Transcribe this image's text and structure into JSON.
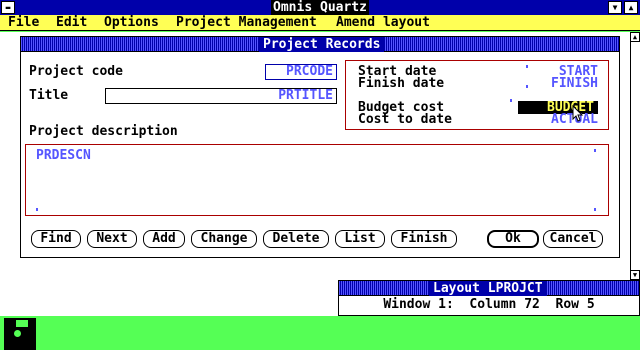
{
  "app": {
    "title": "Omnis Quartz"
  },
  "menu": [
    "File",
    "Edit",
    "Options",
    "Project Management",
    "Amend layout"
  ],
  "window": {
    "title": "Project Records",
    "fields": {
      "project_code": {
        "label": "Project code",
        "value": "PRCODE"
      },
      "title": {
        "label": "Title",
        "value": "PRTITLE"
      },
      "description": {
        "label": "Project description",
        "value": "PRDESCN"
      },
      "start_date": {
        "label": "Start date",
        "value": "START"
      },
      "finish_date": {
        "label": "Finish date",
        "value": "FINISH"
      },
      "budget_cost": {
        "label": "Budget cost",
        "value": "BUDGET"
      },
      "cost_to_date": {
        "label": "Cost to date",
        "value": "ACTUAL"
      }
    },
    "buttons": [
      "Find",
      "Next",
      "Add",
      "Change",
      "Delete",
      "List",
      "Finish",
      "Ok",
      "Cancel"
    ]
  },
  "layout_window": {
    "title": "Layout LPROJCT",
    "status": "Window 1:  Column 72  Row 5"
  },
  "colors": {
    "menubar": "#ffff55",
    "titlebar": "#0000aa",
    "desktop": "#55ff55",
    "field_text": "#5555ff",
    "box_border": "#aa0000"
  }
}
